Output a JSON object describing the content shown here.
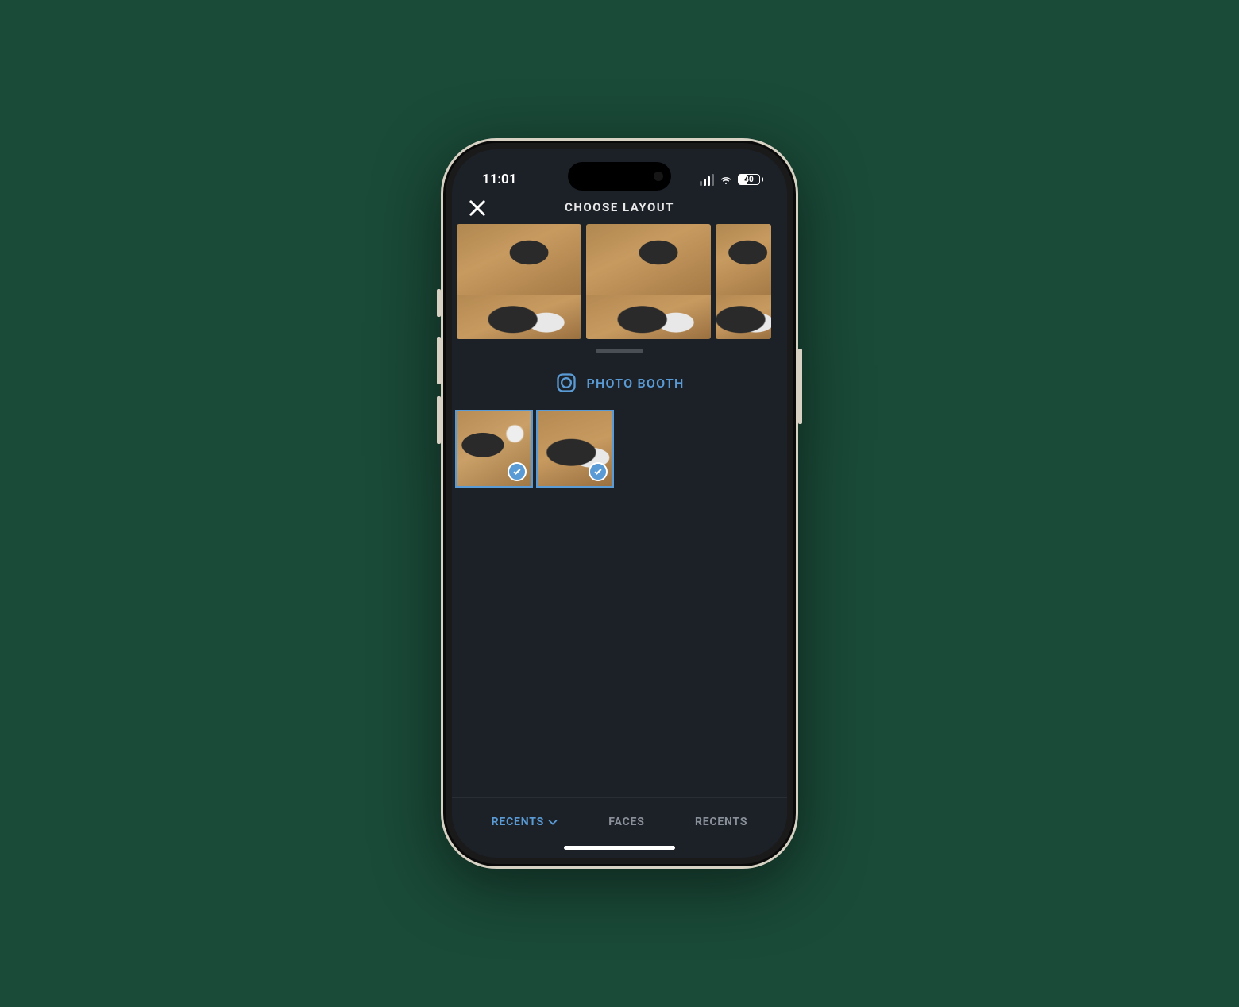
{
  "status": {
    "time": "11:01",
    "battery_pct": "40"
  },
  "header": {
    "title": "CHOOSE LAYOUT"
  },
  "photo_booth": {
    "label": "PHOTO BOOTH"
  },
  "bottom_tabs": {
    "items": [
      {
        "label": "RECENTS",
        "active": true,
        "has_dropdown": true
      },
      {
        "label": "FACES",
        "active": false,
        "has_dropdown": false
      },
      {
        "label": "RECENTS",
        "active": false,
        "has_dropdown": false
      }
    ]
  },
  "thumbnails": {
    "selected_count": 2
  }
}
